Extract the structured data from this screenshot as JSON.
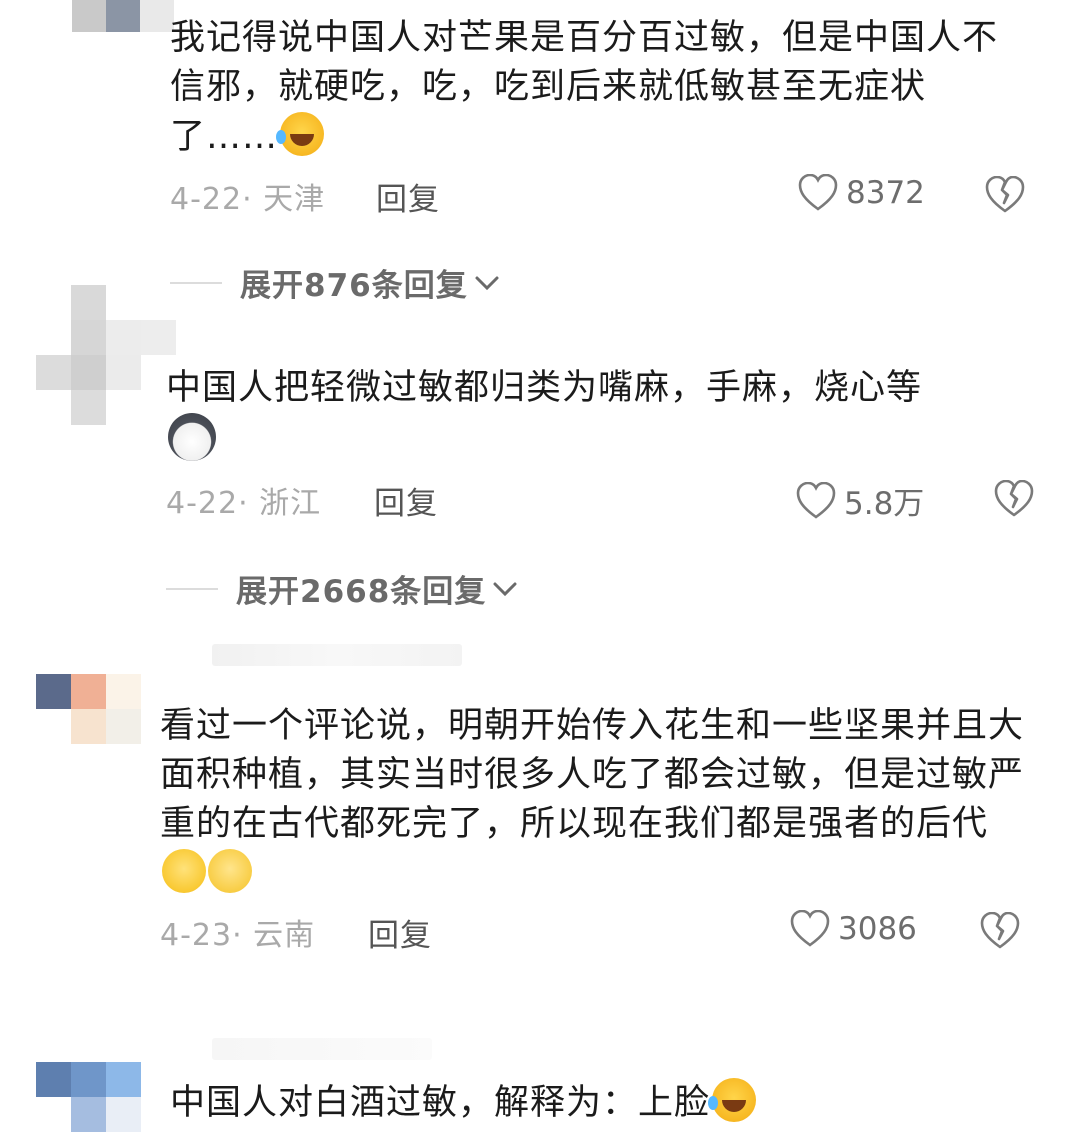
{
  "comments": [
    {
      "text": "我记得说中国人对芒果是百分百过敏，但是中国人不信邪，就硬吃，吃，吃到后来就低敏甚至无症状了……",
      "emoji": "laugh-tears-emoji",
      "date": "4-22",
      "location": "天津",
      "reply_label": "回复",
      "likes": "8372",
      "expand_label": "展开876条回复"
    },
    {
      "text": "中国人把轻微过敏都归类为嘴麻，手麻，烧心等",
      "emoji": "husky-emoji",
      "date": "4-22",
      "location": "浙江",
      "reply_label": "回复",
      "likes": "5.8万",
      "expand_label": "展开2668条回复"
    },
    {
      "text": "看过一个评论说，明朝开始传入花生和一些坚果并且大面积种植，其实当时很多人吃了都会过敏，但是过敏严重的在古代都死完了，所以现在我们都是强者的后代",
      "emoji": "dizzy-emoji",
      "date": "4-23",
      "location": "云南",
      "reply_label": "回复",
      "likes": "3086"
    },
    {
      "text": "中国人对白酒过敏，解释为：上脸",
      "emoji": "laugh-tears-emoji"
    }
  ],
  "colors": {
    "text": "#1b1b1b",
    "meta": "#a9a9a9",
    "action": "#555555"
  }
}
